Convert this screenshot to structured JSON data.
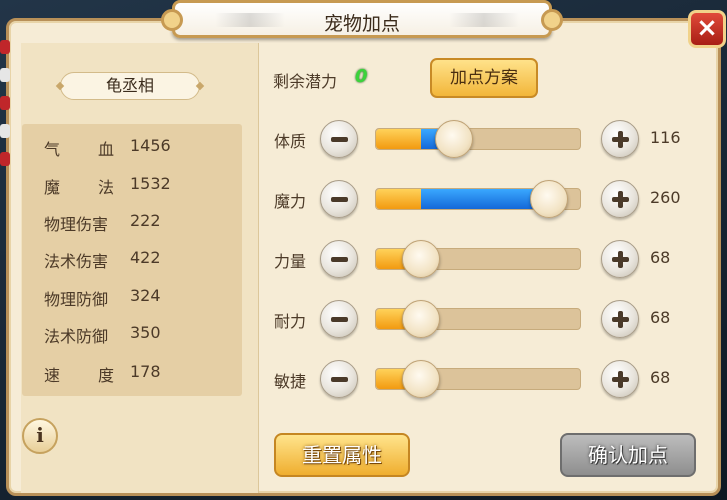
{
  "window": {
    "title": "宠物加点",
    "close_label": "×"
  },
  "pet": {
    "name": "龟丞相"
  },
  "stats": [
    {
      "label_chars": [
        "气",
        "血"
      ],
      "value": "1456"
    },
    {
      "label_chars": [
        "魔",
        "法"
      ],
      "value": "1532"
    },
    {
      "label": "物理伤害",
      "value": "222"
    },
    {
      "label": "法术伤害",
      "value": "422"
    },
    {
      "label": "物理防御",
      "value": "324"
    },
    {
      "label": "法术防御",
      "value": "350"
    },
    {
      "label_chars": [
        "速",
        "度"
      ],
      "value": "178"
    }
  ],
  "info_button": {
    "label": "i"
  },
  "potential": {
    "label": "剩余潜力",
    "value": "0"
  },
  "plan_button": {
    "label": "加点方案"
  },
  "attributes": [
    {
      "label": "体质",
      "value": "116",
      "base_fraction": 0.22,
      "added_fraction": 0.16,
      "knob_fraction": 0.38
    },
    {
      "label": "魔力",
      "value": "260",
      "base_fraction": 0.22,
      "added_fraction": 0.6,
      "knob_fraction": 0.84
    },
    {
      "label": "力量",
      "value": "68",
      "base_fraction": 0.22,
      "added_fraction": 0,
      "knob_fraction": 0.22
    },
    {
      "label": "耐力",
      "value": "68",
      "base_fraction": 0.22,
      "added_fraction": 0,
      "knob_fraction": 0.22
    },
    {
      "label": "敏捷",
      "value": "68",
      "base_fraction": 0.22,
      "added_fraction": 0,
      "knob_fraction": 0.22
    }
  ],
  "buttons": {
    "reset": "重置属性",
    "confirm": "确认加点"
  },
  "colors": {
    "potential_value": "#3bd33b",
    "fill_base": "#f29a10",
    "fill_added": "#1468d8",
    "close_button": "#c0262a"
  }
}
